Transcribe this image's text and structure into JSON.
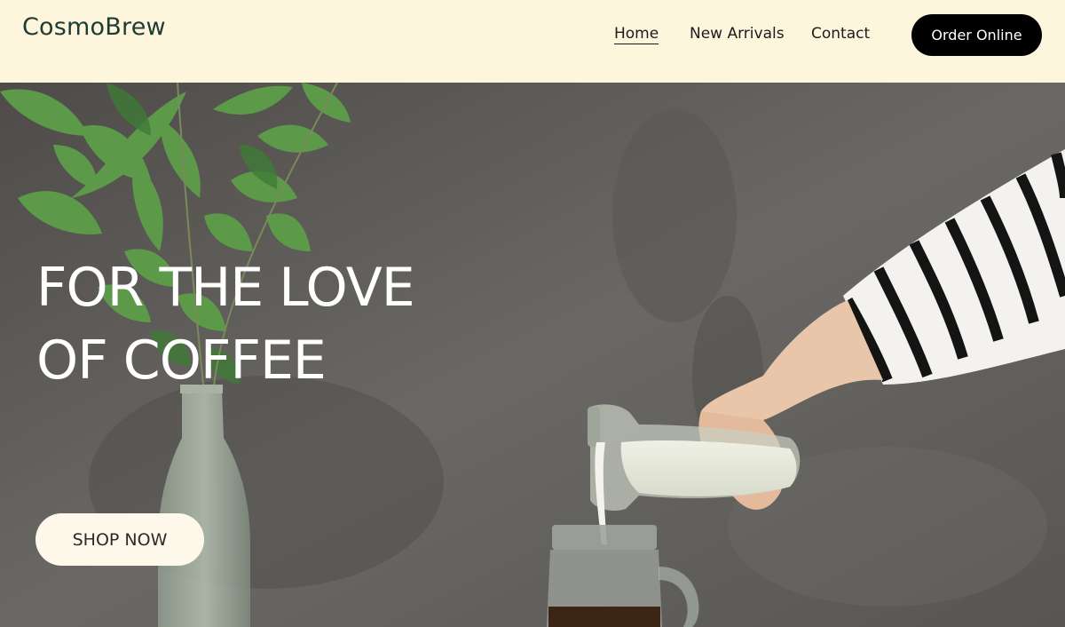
{
  "header": {
    "logo": "CosmoBrew",
    "nav": [
      {
        "label": "Home",
        "active": true
      },
      {
        "label": "New Arrivals",
        "active": false
      },
      {
        "label": "Contact",
        "active": false
      }
    ],
    "cta_label": "Order Online"
  },
  "hero": {
    "headline_line1": "FOR THE LOVE",
    "headline_line2": "OF COFFEE",
    "button_label": "SHOP NOW"
  },
  "colors": {
    "header_bg": "#fdf6dc",
    "logo": "#1f3b35",
    "cta_bg": "#000000",
    "shop_button_bg": "#fdf8ea"
  }
}
